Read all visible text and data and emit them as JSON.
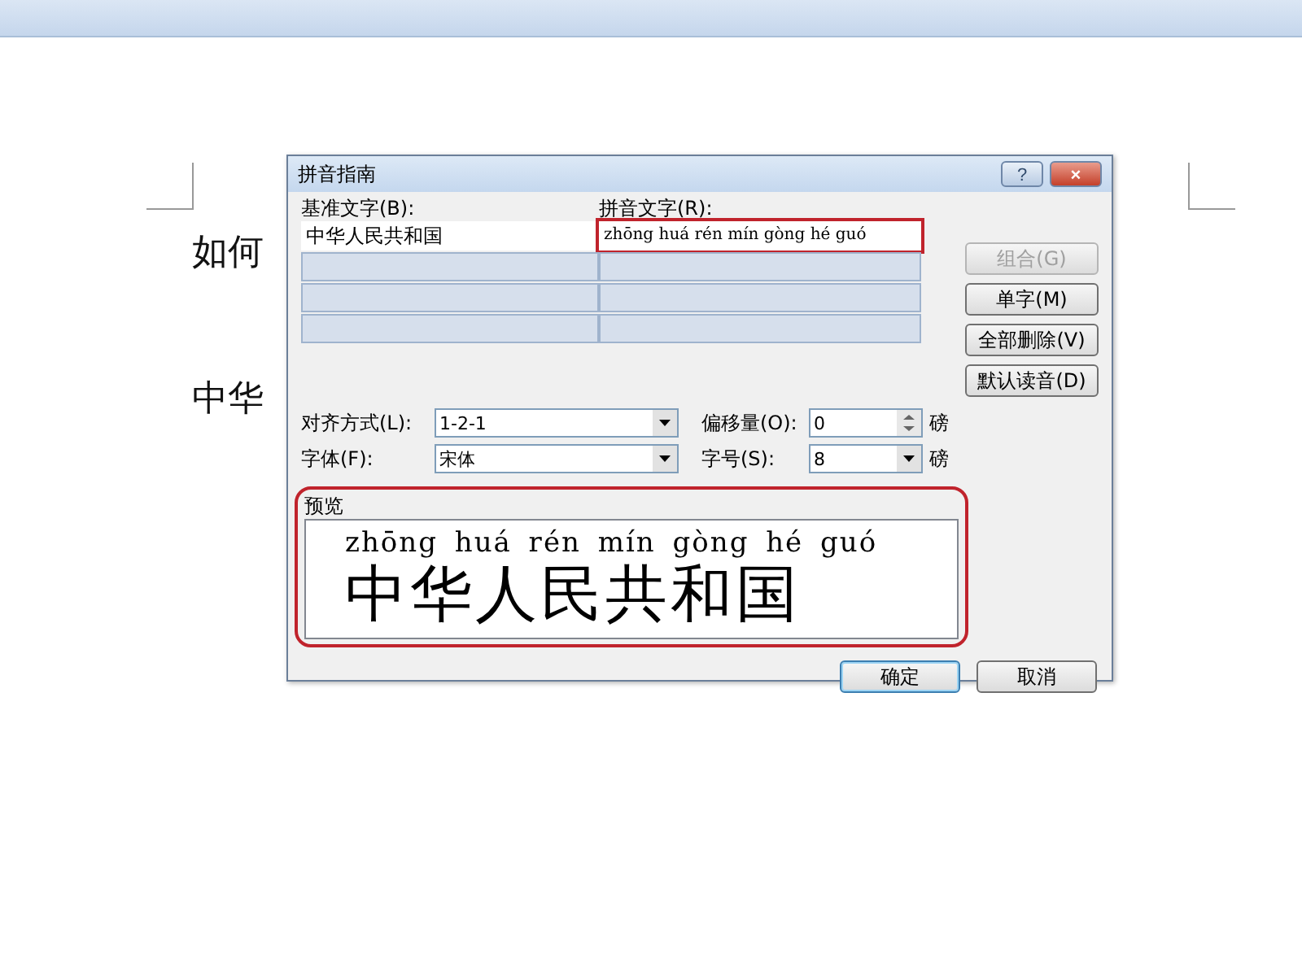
{
  "document": {
    "lines": [
      "如何",
      "中华"
    ]
  },
  "dialog": {
    "title": "拼音指南",
    "help_button": "?",
    "close_button": "×",
    "base_label": "基准文字(B):",
    "ruby_label": "拼音文字(R):",
    "rows": [
      {
        "base": "中华人民共和国",
        "ruby": "zhōng huá rén mín gòng hé guó",
        "highlighted": true
      }
    ],
    "side_buttons": [
      {
        "label": "组合(G)",
        "disabled": true
      },
      {
        "label": "单字(M)",
        "disabled": false
      },
      {
        "label": "全部删除(V)",
        "disabled": false
      },
      {
        "label": "默认读音(D)",
        "disabled": false
      }
    ],
    "alignment": {
      "label": "对齐方式(L):",
      "value": "1-2-1"
    },
    "offset": {
      "label": "偏移量(O):",
      "value": "0",
      "unit": "磅"
    },
    "font": {
      "label": "字体(F):",
      "value": "宋体"
    },
    "size": {
      "label": "字号(S):",
      "value": "8",
      "unit": "磅"
    },
    "preview": {
      "label": "预览",
      "pinyin": "zhōng huá rén mín gòng hé guó",
      "text": "中华人民共和国",
      "highlighted": true
    },
    "ok_button": {
      "label": "确定",
      "focused": true
    },
    "cancel_button": {
      "label": "取消",
      "focused": false
    }
  }
}
